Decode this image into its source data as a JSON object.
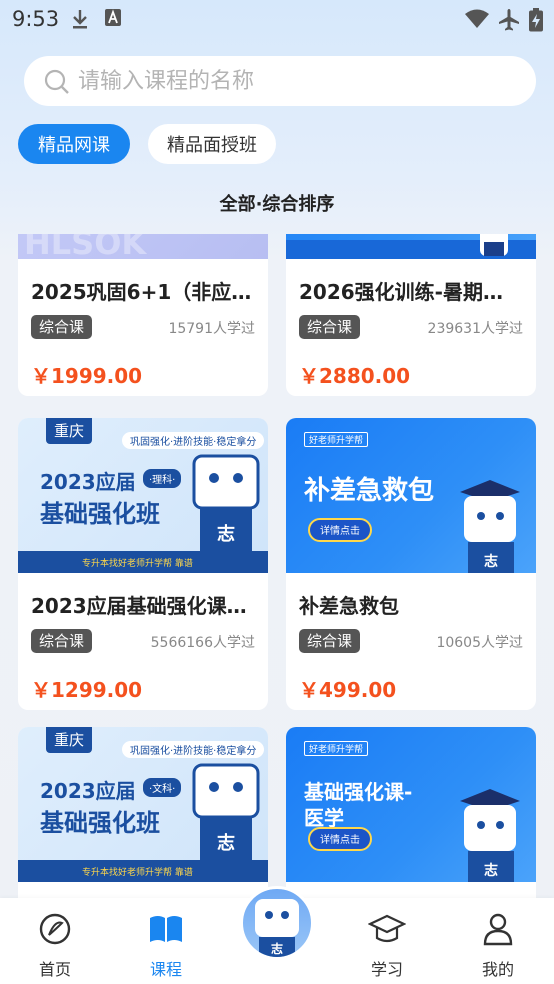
{
  "status": {
    "time": "9:53"
  },
  "search": {
    "placeholder": "请输入课程的名称"
  },
  "tabs": [
    {
      "label": "精品网课"
    },
    {
      "label": "精品面授班"
    }
  ],
  "sort_label": "全部·综合排序",
  "courses": [
    {
      "title": "2025巩固6+1（非应届…",
      "tag": "综合课",
      "count": "15791人学过",
      "price": "￥1999.00"
    },
    {
      "title": "2026强化训练-暑期…",
      "tag": "综合课",
      "count": "239631人学过",
      "price": "￥2880.00"
    },
    {
      "title": "2023应届基础强化课…",
      "tag": "综合课",
      "count": "5566166人学过",
      "price": "￥1299.00",
      "cover": {
        "city": "重庆",
        "sub": "巩固强化·进阶技能·稳定拿分",
        "line1": "2023应届",
        "badge": "·理科·",
        "line2": "基础强化班",
        "footer": "专升本找好老师升学帮 靠谱"
      }
    },
    {
      "title": "补差急救包",
      "tag": "综合课",
      "count": "10605人学过",
      "price": "￥499.00",
      "cover": {
        "brand": "好老师升学帮",
        "big": "补差急救包",
        "btn": "详情点击"
      }
    },
    {
      "cover": {
        "city": "重庆",
        "sub": "巩固强化·进阶技能·稳定拿分",
        "line1": "2023应届",
        "badge": "·文科·",
        "line2": "基础强化班",
        "footer": "专升本找好老师升学帮 靠谱"
      }
    },
    {
      "cover": {
        "brand": "好老师升学帮",
        "big_l1": "基础强化课-",
        "big_l2": "医学",
        "btn": "详情点击"
      }
    }
  ],
  "nav": [
    {
      "label": "首页"
    },
    {
      "label": "课程"
    },
    {
      "label": "学习"
    },
    {
      "label": "我的"
    }
  ],
  "colors": {
    "accent": "#1a86f0",
    "price": "#f4511e",
    "tag_bg": "#555555"
  }
}
